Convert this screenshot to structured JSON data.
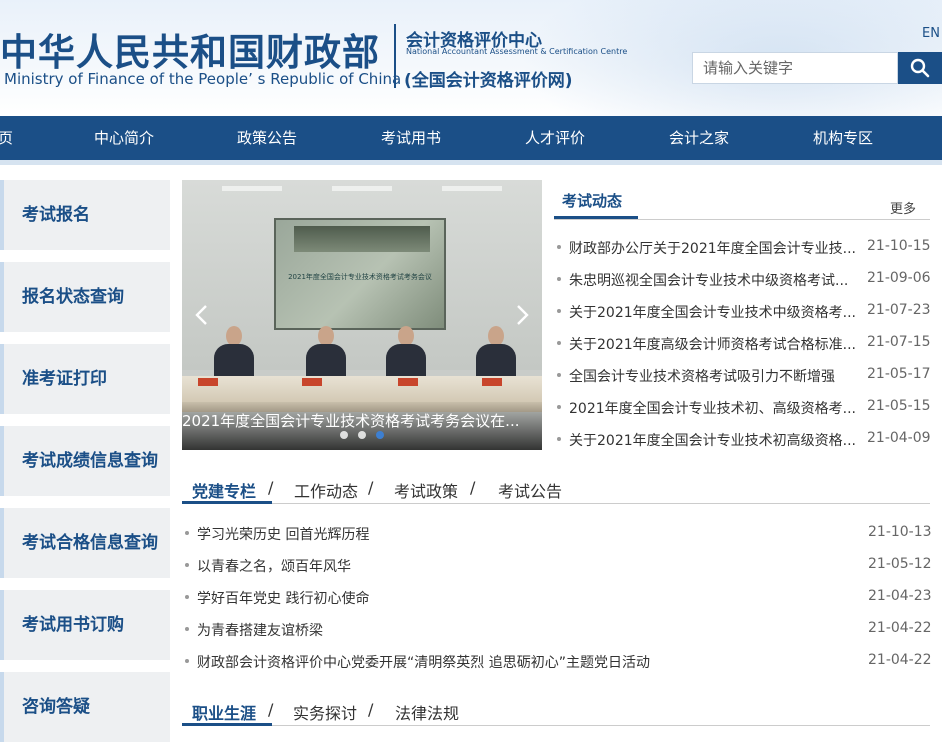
{
  "header": {
    "brand_cn": "中华人民共和国财政部",
    "brand_en": "Ministry of Finance of the People’ s Republic of China",
    "center_name": "会计资格评价中心",
    "center_en": "National Accountant Assessment & Certification Centre",
    "center_site": "(全国会计资格评价网)",
    "lang_link": "EN",
    "search_placeholder": "请输入关键字",
    "search_icon": "search-icon"
  },
  "colors": {
    "primary": "#1b4f87",
    "sidebar_bg": "#eef0f2",
    "accent_blue": "#3d7fd1"
  },
  "nav": {
    "items": [
      "页",
      "中心简介",
      "政策公告",
      "考试用书",
      "人才评价",
      "会计之家",
      "机构专区"
    ]
  },
  "sidebar": {
    "items": [
      "考试报名",
      "报名状态查询",
      "准考证打印",
      "考试成绩信息查询",
      "考试合格信息查询",
      "考试用书订购",
      "咨询答疑"
    ]
  },
  "carousel": {
    "screen_title": "2021年度全国会计专业技术资格考试考务会议",
    "caption": "2021年度全国会计专业技术资格考试考务会议在...",
    "slide_count": 3,
    "active_slide": 3
  },
  "exam_news": {
    "title": "考试动态",
    "more": "更多",
    "items": [
      {
        "title": "财政部办公厅关于2021年度全国会计专业技...",
        "date": "21-10-15"
      },
      {
        "title": "朱忠明巡视全国会计专业技术中级资格考试...",
        "date": "21-09-06"
      },
      {
        "title": "关于2021年度全国会计专业技术中级资格考...",
        "date": "21-07-23"
      },
      {
        "title": "关于2021年度高级会计师资格考试合格标准...",
        "date": "21-07-15"
      },
      {
        "title": "全国会计专业技术资格考试吸引力不断增强",
        "date": "21-05-17"
      },
      {
        "title": "2021年度全国会计专业技术初、高级资格考...",
        "date": "21-05-15"
      },
      {
        "title": "关于2021年度全国会计专业技术初高级资格...",
        "date": "21-04-09"
      }
    ]
  },
  "party_tabs": {
    "tabs": [
      "党建专栏",
      "工作动态",
      "考试政策",
      "考试公告"
    ],
    "separator": "/",
    "items": [
      {
        "title": "学习光荣历史 回首光辉历程",
        "date": "21-10-13"
      },
      {
        "title": "以青春之名，颂百年风华",
        "date": "21-05-12"
      },
      {
        "title": "学好百年党史 践行初心使命",
        "date": "21-04-23"
      },
      {
        "title": "为青春搭建友谊桥梁",
        "date": "21-04-22"
      },
      {
        "title": "财政部会计资格评价中心党委开展“清明祭英烈 追思砺初心”主题党日活动",
        "date": "21-04-22"
      }
    ]
  },
  "career_tabs": {
    "tabs": [
      "职业生涯",
      "实务探讨",
      "法律法规"
    ]
  }
}
